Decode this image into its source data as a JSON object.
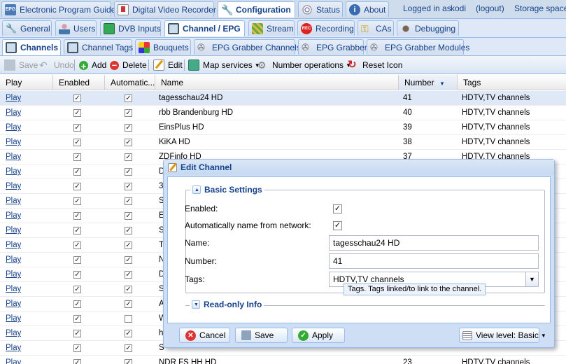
{
  "top_tabs": [
    {
      "label": "Electronic Program Guide",
      "icon": "epg-icon"
    },
    {
      "label": "Digital Video Recorder",
      "icon": "dvr-download-icon"
    },
    {
      "label": "Configuration",
      "icon": "wrench-icon"
    },
    {
      "label": "Status",
      "icon": "eye-icon"
    },
    {
      "label": "About",
      "icon": "info-icon"
    }
  ],
  "user": {
    "logged_in": "Logged in as",
    "username": "kodi",
    "logout": "(logout)",
    "storage": "Storage space:"
  },
  "config_tabs": [
    {
      "label": "General"
    },
    {
      "label": "Users"
    },
    {
      "label": "DVB Inputs"
    },
    {
      "label": "Channel / EPG"
    },
    {
      "label": "Stream"
    },
    {
      "label": "Recording"
    },
    {
      "label": "CAs"
    },
    {
      "label": "Debugging"
    }
  ],
  "channel_tabs": [
    {
      "label": "Channels"
    },
    {
      "label": "Channel Tags"
    },
    {
      "label": "Bouquets"
    },
    {
      "label": "EPG Grabber Channels"
    },
    {
      "label": "EPG Grabber"
    },
    {
      "label": "EPG Grabber Modules"
    }
  ],
  "toolbar": {
    "save": "Save",
    "undo": "Undo",
    "add": "Add",
    "delete": "Delete",
    "edit": "Edit",
    "map_services": "Map services",
    "number_operations": "Number operations",
    "reset_icon": "Reset Icon"
  },
  "columns": {
    "play": "Play",
    "enabled": "Enabled",
    "automatic": "Automatic...",
    "name": "Name",
    "number": "Number",
    "tags": "Tags"
  },
  "rows": [
    {
      "play": "Play",
      "enabled": true,
      "auto": true,
      "name": "tagesschau24 HD",
      "number": "41",
      "tags": "HDTV,TV channels"
    },
    {
      "play": "Play",
      "enabled": true,
      "auto": true,
      "name": "rbb Brandenburg HD",
      "number": "40",
      "tags": "HDTV,TV channels"
    },
    {
      "play": "Play",
      "enabled": true,
      "auto": true,
      "name": "EinsPlus HD",
      "number": "39",
      "tags": "HDTV,TV channels"
    },
    {
      "play": "Play",
      "enabled": true,
      "auto": true,
      "name": "KiKA HD",
      "number": "38",
      "tags": "HDTV,TV channels"
    },
    {
      "play": "Play",
      "enabled": true,
      "auto": true,
      "name": "ZDFinfo HD",
      "number": "37",
      "tags": "HDTV,TV channels"
    },
    {
      "play": "Play",
      "enabled": true,
      "auto": true,
      "name": "D",
      "number": "",
      "tags": ""
    },
    {
      "play": "Play",
      "enabled": true,
      "auto": true,
      "name": "3",
      "number": "",
      "tags": "s,ZD"
    },
    {
      "play": "Play",
      "enabled": true,
      "auto": true,
      "name": "S",
      "number": "",
      "tags": ""
    },
    {
      "play": "Play",
      "enabled": true,
      "auto": true,
      "name": "E",
      "number": "",
      "tags": ""
    },
    {
      "play": "Play",
      "enabled": true,
      "auto": true,
      "name": "S",
      "number": "",
      "tags": ""
    },
    {
      "play": "Play",
      "enabled": true,
      "auto": true,
      "name": "T",
      "number": "",
      "tags": ""
    },
    {
      "play": "Play",
      "enabled": true,
      "auto": true,
      "name": "N",
      "number": "",
      "tags": ""
    },
    {
      "play": "Play",
      "enabled": true,
      "auto": true,
      "name": "D",
      "number": "",
      "tags": ""
    },
    {
      "play": "Play",
      "enabled": true,
      "auto": true,
      "name": "S",
      "number": "",
      "tags": ""
    },
    {
      "play": "Play",
      "enabled": true,
      "auto": true,
      "name": "A",
      "number": "",
      "tags": "V c"
    },
    {
      "play": "Play",
      "enabled": true,
      "auto": false,
      "name": "W",
      "number": "",
      "tags": ""
    },
    {
      "play": "Play",
      "enabled": true,
      "auto": true,
      "name": "h",
      "number": "",
      "tags": ""
    },
    {
      "play": "Play",
      "enabled": true,
      "auto": true,
      "name": "S",
      "number": "",
      "tags": ""
    },
    {
      "play": "Play",
      "enabled": true,
      "auto": true,
      "name": "NDR FS HH HD",
      "number": "23",
      "tags": "HDTV,TV channels"
    }
  ],
  "dialog": {
    "title": "Edit Channel",
    "basic_settings": "Basic Settings",
    "enabled_label": "Enabled:",
    "autoname_label": "Automatically name from network:",
    "name_label": "Name:",
    "name_value": "tagesschau24 HD",
    "number_label": "Number:",
    "number_value": "41",
    "tags_label": "Tags:",
    "tags_value": "HDTV,TV channels",
    "tooltip": "Tags. Tags linked/to link to the channel.",
    "readonly_info": "Read-only Info",
    "cancel": "Cancel",
    "save": "Save",
    "apply": "Apply",
    "view_level": "View level: Basic"
  }
}
